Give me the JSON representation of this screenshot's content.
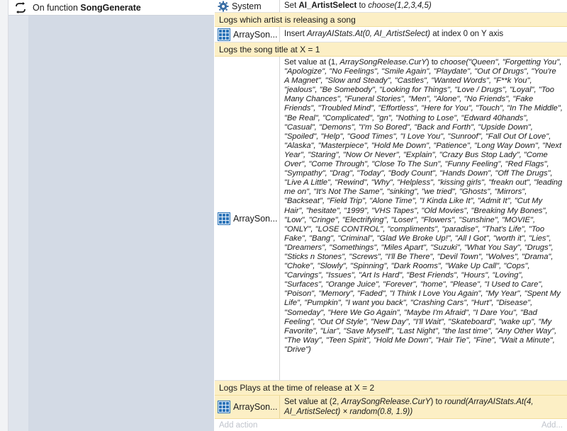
{
  "event": {
    "prefix": "On function",
    "function_name": "SongGenerate"
  },
  "actions": [
    {
      "kind": "action",
      "object_name": "System",
      "icon": "gear-icon",
      "text_prefix": "Set ",
      "text_bold": "AI_ArtistSelect",
      "text_mid": " to ",
      "text_italic": "choose(1,2,3,4,5)"
    },
    {
      "kind": "comment",
      "text": "Logs which artist is releasing a song"
    },
    {
      "kind": "action",
      "object_name": "ArraySon...",
      "icon": "grid-icon",
      "text_prefix": "Insert ",
      "text_italic": "ArrayAIStats.At(0, AI_ArtistSelect)",
      "text_suffix": " at index 0 on Y axis"
    },
    {
      "kind": "comment",
      "text": "Logs the song title at X = 1"
    },
    {
      "kind": "action",
      "object_name": "ArraySon...",
      "icon": "grid-icon",
      "text_prefix": "Set value at (1, ",
      "text_italic": "ArraySongRelease.CurY",
      "text_mid": ") to ",
      "text_long": "choose(\"Queen\", \"Forgetting You\", \"Apologize\", \"No Feelings\", \"Smile Again\", \"Playdate\", \"Out Of Drugs\", \"You're A Magnet\", \"Slow and Steady\", \"Castles\", \"Wanted Words\", \"F**k You\", \"jealous\", \"Be Somebody\", \"Looking for Things\", \"Love / Drugs\", \"Loyal\", \"Too Many Chances\", \"Funeral Stories\", \"Men\", \"Alone\", \"No Friends\", \"Fake Friends\", \"Troubled Mind\", \"Effortless\", \"Here for You\", \"Touch\", \"In The Middle\", \"Be Real\", \"Complicated\", \"gn\", \"Nothing to Lose\", \"Edward 40hands\", \"Casual\", \"Demons\", \"I'm So Bored\", \"Back and Forth\", \"Upside Down\", \"Spoiled\", \"Help\", \"Good Times\", \"I Love You\", \"Sunroof\", \"Fall Out Of Love\", \"Alaska\", \"Masterpiece\", \"Hold Me Down\", \"Patience\", \"Long Way Down\", \"Next Year\", \"Staring\", \"Now Or Never\", \"Explain\", \"Crazy Bus Stop Lady\", \"Come Over\", \"Come Through\", \"Close To The Sun\", \"Funny Feeling\", \"Red Flags\", \"Sympathy\", \"Drag\", \"Today\", \"Body Count\", \"Hands Down\", \"Off The Drugs\", \"Live A Little\", \"Rewind\", \"Why\", \"Helpless\", \"kissing girls\", \"freakn out\", \"leading me on\", \"It's Not The Same\", \"sinking\", \"we tried\", \"Ghosts\", \"Mirrors\", \"Backseat\", \"Field Trip\", \"Alone Time\", \"I Kinda Like It\", \"Admit It\", \"Cut My Hair\", \"hesitate\", \"1999\", \"VHS Tapes\", \"Old Movies\", \"Breaking My Bones\", \"Low\", \"Cringe\", \"Electrifying\", \"Loser\", \"Flowers\", \"Sunshine\", \"MOVIE\", \"ONLY\", \"LOSE CONTROL\", \"compliments\", \"paradise\", \"That's Life\", \"Too Fake\", \"Bang\", \"Criminal\", \"Glad We Broke Up!\", \"All I Got\", \"worth it\", \"Lies\", \"Dreamers\", \"Somethings\", \"Miles Apart\", \"Suzuki\", \"What You Say\", \"Drugs\", \"Sticks n Stones\", \"Screws\", \"I'll Be There\", \"Devil Town\", \"Wolves\", \"Drama\", \"Choke\", \"Slowly\", \"Spinning\", \"Dark Rooms\", \"Wake Up Call\", \"Cops\", \"Carvings\", \"Issues\", \"Art Is Hard\", \"Best Friends\", \"Hours\", \"Loving\", \"Surfaces\", \"Orange Juice\", \"Forever\", \"home\", \"Please\", \"I Used to Care\", \"Poison\", \"Memory\", \"Faded\", \"I Think I Love You Again\", \"My Year\", \"Spent My Life\", \"Pumpkin\", \"I want you back\", \"Crashing Cars\", \"Hurt\", \"Disease\", \"Someday\", \"Here We Go Again\", \"Maybe I'm Afraid\", \"I Dare You\", \"Bad Feeling\", \"Out Of Style\", \"New Day\", \"I'll Wait\", \"Skateboard\", \"wake up\", \"My Favorite\", \"Liar\", \"Save Myself\", \"Last Night\", \"the last time\", \"Any Other Way\", \"The Way\", \"Teen Spirit\", \"Hold Me Down\", \"Hair Tie\", \"Fine\", \"Wait a Minute\", \"Drive\")"
    },
    {
      "kind": "comment",
      "text": "Logs Plays at the time of release at X = 2"
    },
    {
      "kind": "action",
      "object_name": "ArraySon...",
      "icon": "grid-icon",
      "text_prefix": "Set value at (2, ",
      "text_italic": "ArraySongRelease.CurY",
      "text_mid": ") to ",
      "text_long": "round(ArrayAIStats.At(4, AI_ArtistSelect) × random(0.8, 1.9))"
    }
  ],
  "footer": {
    "add_action": "Add action",
    "add_right": "Add..."
  }
}
